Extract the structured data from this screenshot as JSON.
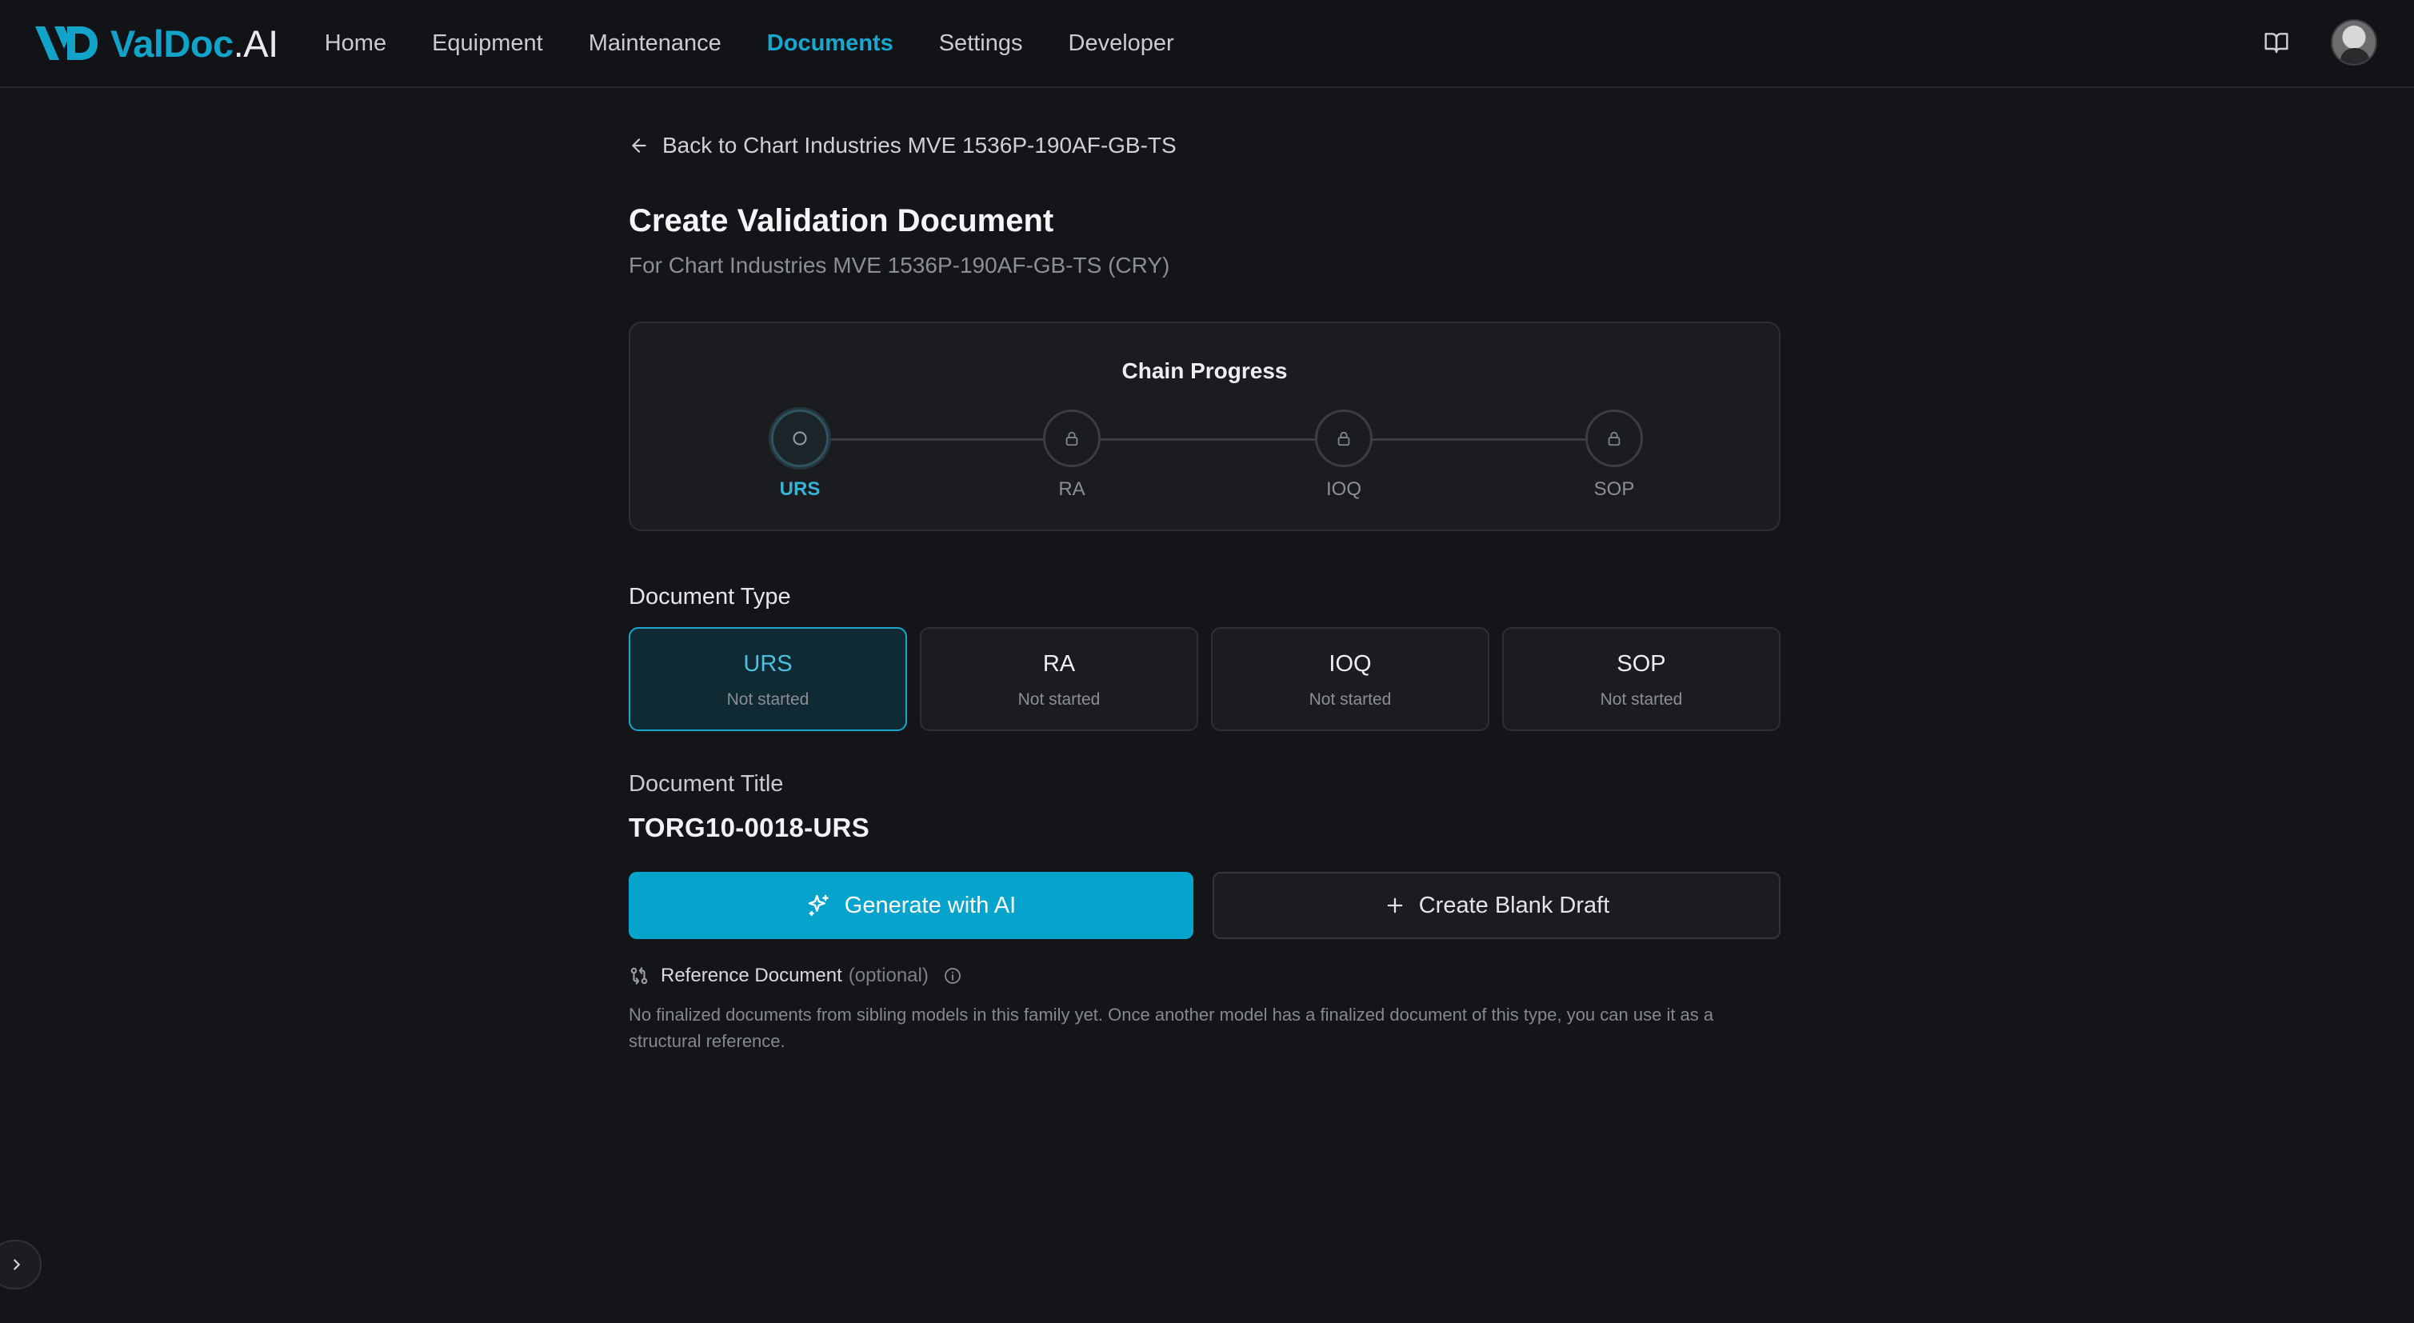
{
  "app": {
    "logo_brand": "ValDoc",
    "logo_tld": ".AI",
    "brand_color": "#12a3c8"
  },
  "nav": {
    "items": [
      {
        "label": "Home",
        "active": false
      },
      {
        "label": "Equipment",
        "active": false
      },
      {
        "label": "Maintenance",
        "active": false
      },
      {
        "label": "Documents",
        "active": true
      },
      {
        "label": "Settings",
        "active": false
      },
      {
        "label": "Developer",
        "active": false
      }
    ],
    "right_icons": [
      "book-open-icon",
      "user-avatar"
    ]
  },
  "page": {
    "back_label": "Back to Chart Industries MVE 1536P-190AF-GB-TS",
    "title": "Create Validation Document",
    "subtitle": "For Chart Industries MVE 1536P-190AF-GB-TS (CRY)"
  },
  "chain": {
    "title": "Chain Progress",
    "steps": [
      {
        "label": "URS",
        "state": "current",
        "icon": "circle-icon"
      },
      {
        "label": "RA",
        "state": "locked",
        "icon": "lock-icon"
      },
      {
        "label": "IOQ",
        "state": "locked",
        "icon": "lock-icon"
      },
      {
        "label": "SOP",
        "state": "locked",
        "icon": "lock-icon"
      }
    ]
  },
  "document_type": {
    "label": "Document Type",
    "options": [
      {
        "name": "URS",
        "status": "Not started",
        "selected": true
      },
      {
        "name": "RA",
        "status": "Not started",
        "selected": false
      },
      {
        "name": "IOQ",
        "status": "Not started",
        "selected": false
      },
      {
        "name": "SOP",
        "status": "Not started",
        "selected": false
      }
    ]
  },
  "document_title": {
    "label": "Document Title",
    "value": "TORG10-0018-URS"
  },
  "actions": {
    "generate_label": "Generate with AI",
    "blank_label": "Create Blank Draft",
    "primary_color": "#06a3cc"
  },
  "reference": {
    "label": "Reference Document",
    "optional": "(optional)",
    "note": "No finalized documents from sibling models in this family yet. Once another model has a finalized document of this type, you can use it as a structural reference."
  }
}
